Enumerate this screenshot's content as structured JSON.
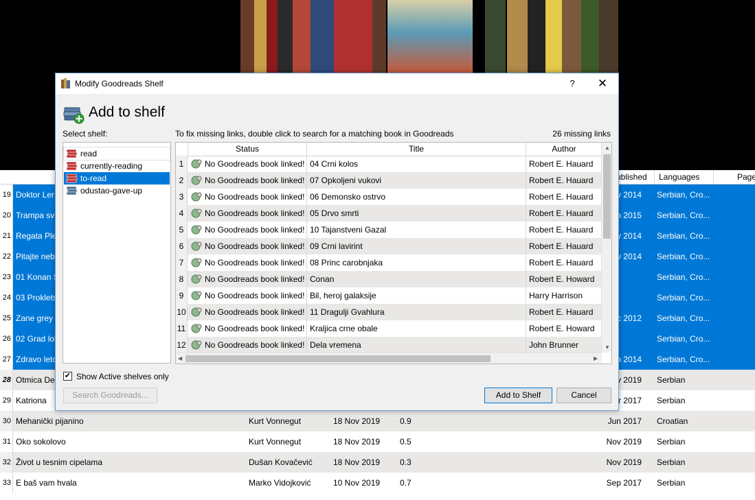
{
  "dialog": {
    "window_title": "Modify Goodreads Shelf",
    "help": "?",
    "close": "✕",
    "heading": "Add to shelf",
    "select_shelf_label": "Select shelf:",
    "hint": "To fix missing links, double click to search for a matching book in Goodreads",
    "missing_links": "26 missing links",
    "shelves": [
      "read",
      "currently-reading",
      "to-read",
      "odustao-gave-up"
    ],
    "selected_shelf_index": 2,
    "show_active_label": "Show Active shelves only",
    "show_active_checked": true,
    "search_button": "Search Goodreads...",
    "add_button": "Add to Shelf",
    "cancel_button": "Cancel",
    "columns": [
      "Status",
      "Title",
      "Author"
    ],
    "rows": [
      {
        "n": "1",
        "status": "No Goodreads book linked!",
        "title": "04 Crni kolos",
        "author": "Robert E. Hauard"
      },
      {
        "n": "2",
        "status": "No Goodreads book linked!",
        "title": "07 Opkoljeni vukovi",
        "author": "Robert E. Hauard"
      },
      {
        "n": "3",
        "status": "No Goodreads book linked!",
        "title": "06 Demonsko ostrvo",
        "author": "Robert E. Hauard"
      },
      {
        "n": "4",
        "status": "No Goodreads book linked!",
        "title": "05 Drvo smrti",
        "author": "Robert E. Hauard"
      },
      {
        "n": "5",
        "status": "No Goodreads book linked!",
        "title": "10 Tajanstveni Gazal",
        "author": "Robert E. Hauard"
      },
      {
        "n": "6",
        "status": "No Goodreads book linked!",
        "title": "09 Crni lavirint",
        "author": "Robert E. Hauard"
      },
      {
        "n": "7",
        "status": "No Goodreads book linked!",
        "title": "08 Princ carobnjaka",
        "author": "Robert E. Hauard"
      },
      {
        "n": "8",
        "status": "No Goodreads book linked!",
        "title": "Conan",
        "author": "Robert E. Howard"
      },
      {
        "n": "9",
        "status": "No Goodreads book linked!",
        "title": "Bil, heroj galaksije",
        "author": "Harry Harrison"
      },
      {
        "n": "10",
        "status": "No Goodreads book linked!",
        "title": "11 Dragulji Gvahlura",
        "author": "Robert E. Hauard"
      },
      {
        "n": "11",
        "status": "No Goodreads book linked!",
        "title": "Kraljica crne obale",
        "author": "Robert E. Howard"
      },
      {
        "n": "12",
        "status": "No Goodreads book linked!",
        "title": "Dela vremena",
        "author": "John Brunner"
      }
    ],
    "colors": {
      "accent": "#0078d7",
      "alt_row": "#e9e8e6",
      "frame": "#f0f0f0"
    }
  },
  "background": {
    "columns": [
      "Published",
      "Languages",
      "Page"
    ],
    "rows": [
      {
        "n": "19",
        "title": "Doktor Ler",
        "author": "",
        "date": "",
        "rating": "",
        "published": "y 2014",
        "lang": "Serbian, Cro...",
        "style": "sel"
      },
      {
        "n": "20",
        "title": "Trampa sv",
        "author": "",
        "date": "",
        "rating": "",
        "published": "n 2015",
        "lang": "Serbian, Cro...",
        "style": "sel"
      },
      {
        "n": "21",
        "title": "Regata Ple",
        "author": "",
        "date": "",
        "rating": "",
        "published": "y 2014",
        "lang": "Serbian, Cro...",
        "style": "sel"
      },
      {
        "n": "22",
        "title": "Pitajte neb",
        "author": "",
        "date": "",
        "rating": "",
        "published": "y 2014",
        "lang": "Serbian, Cro...",
        "style": "sel"
      },
      {
        "n": "23",
        "title": "01 Konan S",
        "author": "",
        "date": "",
        "rating": "",
        "published": "",
        "lang": "Serbian, Cro...",
        "style": "sel"
      },
      {
        "n": "24",
        "title": "03 Proklets",
        "author": "",
        "date": "",
        "rating": "",
        "published": "",
        "lang": "Serbian, Cro...",
        "style": "sel"
      },
      {
        "n": "25",
        "title": "Zane grey",
        "author": "",
        "date": "",
        "rating": "",
        "published": "c 2012",
        "lang": "Serbian, Cro...",
        "style": "sel"
      },
      {
        "n": "26",
        "title": "02 Grad lol",
        "author": "",
        "date": "",
        "rating": "",
        "published": "",
        "lang": "Serbian, Cro...",
        "style": "sel"
      },
      {
        "n": "27",
        "title": "Zdravo leto",
        "author": "",
        "date": "",
        "rating": "",
        "published": "n 2014",
        "lang": "Serbian, Cro...",
        "style": "sel"
      },
      {
        "n": "28",
        "title": "Otmica De",
        "author": "",
        "date": "",
        "rating": "",
        "published": "v 2019",
        "lang": "Serbian",
        "style": "alt"
      },
      {
        "n": "29",
        "title": "Katriona",
        "author": "",
        "date": "",
        "rating": "",
        "published": "r 2017",
        "lang": "Serbian",
        "style": "plain"
      },
      {
        "n": "30",
        "title": "Mehanički pijanino",
        "author": "Kurt Vonnegut",
        "date": "18 Nov 2019",
        "rating": "0.9",
        "published": "Jun 2017",
        "lang": "Croatian",
        "style": "alt"
      },
      {
        "n": "31",
        "title": "Oko sokolovo",
        "author": "Kurt Vonnegut",
        "date": "18 Nov 2019",
        "rating": "0.5",
        "published": "Nov 2019",
        "lang": "Serbian",
        "style": "plain"
      },
      {
        "n": "32",
        "title": "Život u tesnim cipelama",
        "author": "Dušan Kovačević",
        "date": "18 Nov 2019",
        "rating": "0.3",
        "published": "Nov 2019",
        "lang": "Serbian",
        "style": "alt"
      },
      {
        "n": "33",
        "title": "E baš vam hvala",
        "author": "Marko Vidojković",
        "date": "10 Nov 2019",
        "rating": "0.7",
        "published": "Sep 2017",
        "lang": "Serbian",
        "style": "plain"
      }
    ]
  }
}
